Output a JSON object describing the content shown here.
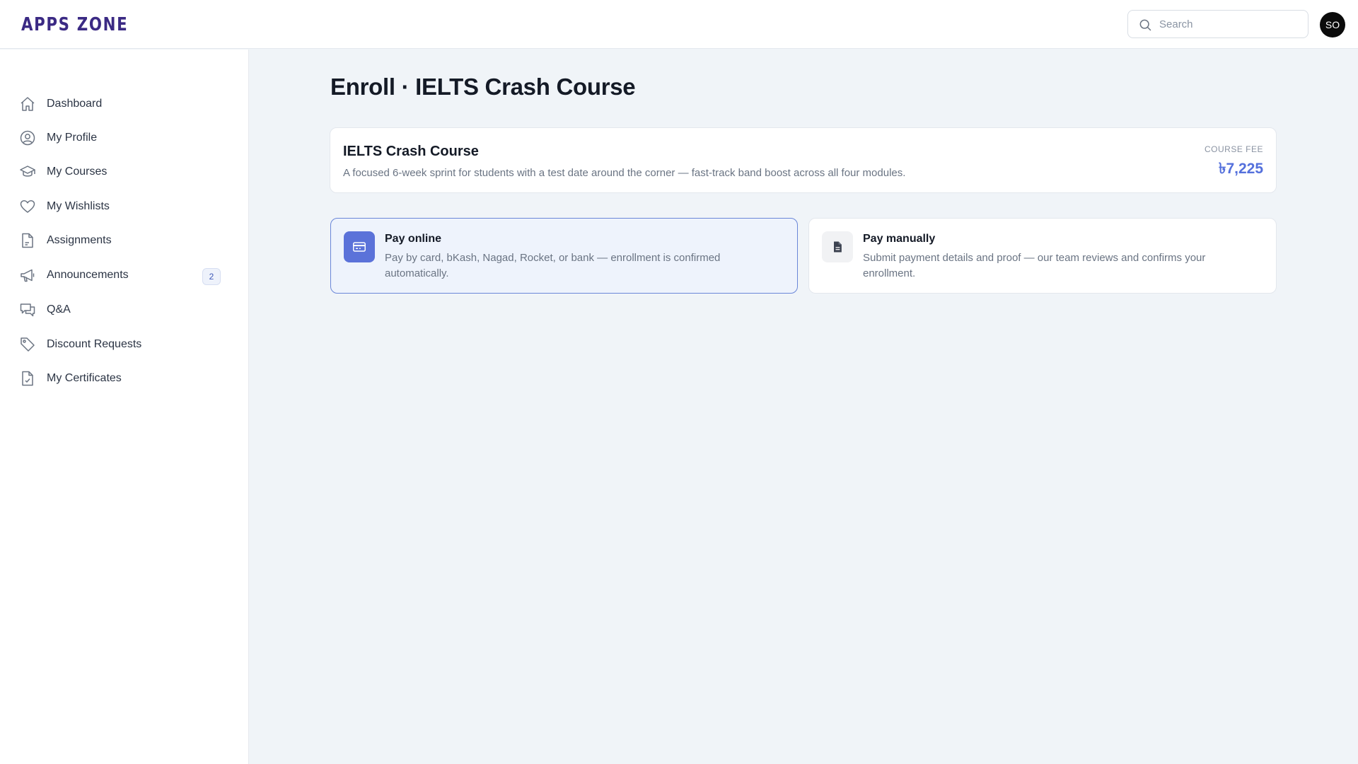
{
  "app": {
    "logo": "APPS ZONE"
  },
  "header": {
    "search_placeholder": "Search",
    "avatar_initials": "SO"
  },
  "sidebar": {
    "items": [
      {
        "label": "Dashboard",
        "icon": "home-icon"
      },
      {
        "label": "My Profile",
        "icon": "user-circle-icon"
      },
      {
        "label": "My Courses",
        "icon": "graduation-cap-icon"
      },
      {
        "label": "My Wishlists",
        "icon": "heart-icon"
      },
      {
        "label": "Assignments",
        "icon": "document-icon"
      },
      {
        "label": "Announcements",
        "icon": "megaphone-icon",
        "badge": "2"
      },
      {
        "label": "Q&A",
        "icon": "chat-icon"
      },
      {
        "label": "Discount Requests",
        "icon": "tag-icon"
      },
      {
        "label": "My Certificates",
        "icon": "certificate-icon"
      }
    ]
  },
  "main": {
    "title": "Enroll · IELTS Crash Course",
    "course": {
      "name": "IELTS Crash Course",
      "description": "A focused 6-week sprint for students with a test date around the corner — fast-track band boost across all four modules.",
      "fee_label": "COURSE FEE",
      "fee_value": "৳7,225"
    },
    "payment_options": [
      {
        "title": "Pay online",
        "description": "Pay by card, bKash, Nagad, Rocket, or bank — enrollment is confirmed automatically.",
        "icon": "credit-card-icon",
        "selected": true
      },
      {
        "title": "Pay manually",
        "description": "Submit payment details and proof — our team reviews and confirms your enrollment.",
        "icon": "file-text-icon",
        "selected": false
      }
    ]
  },
  "colors": {
    "accent": "#5470dc",
    "logo": "#3b2a84",
    "background": "#f0f4f8"
  }
}
